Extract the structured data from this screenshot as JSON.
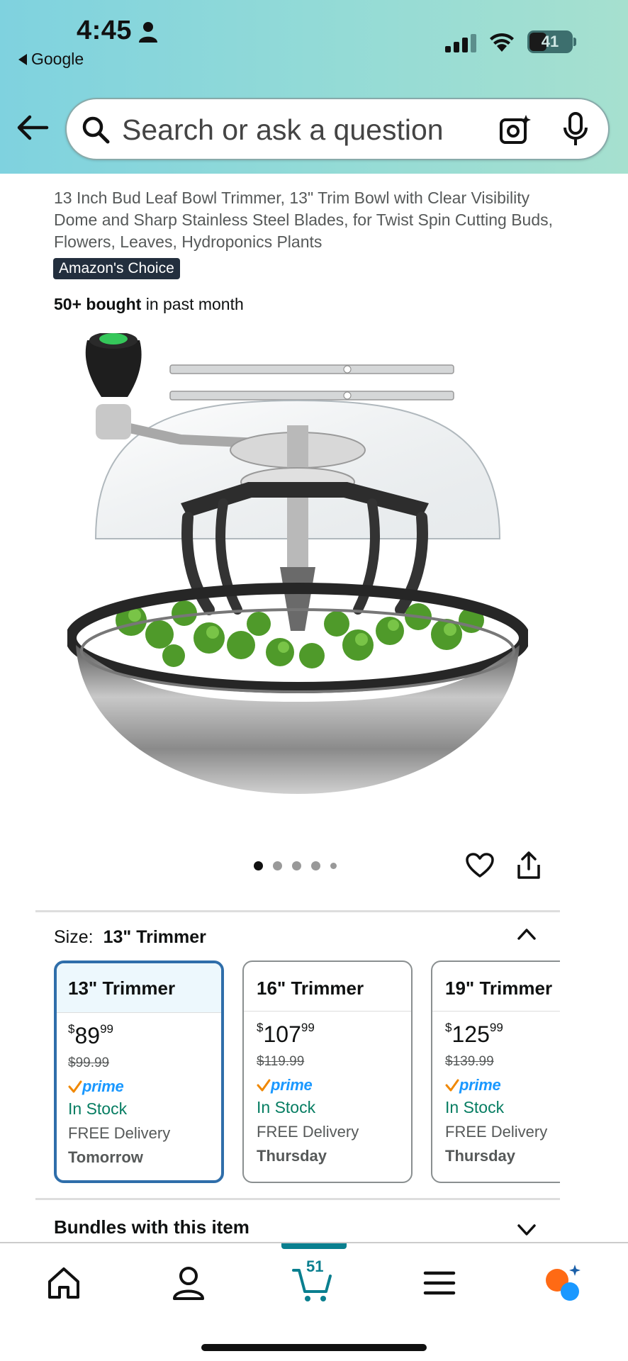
{
  "status_bar": {
    "time": "4:45",
    "back_app": "Google",
    "battery": "41"
  },
  "search": {
    "placeholder": "Search or ask a question"
  },
  "product": {
    "title": "13 Inch Bud Leaf Bowl Trimmer, 13\" Trim Bowl with Clear Visibility Dome and Sharp Stainless Steel Blades, for Twist Spin Cutting Buds, Flowers, Leaves, Hydroponics Plants",
    "badge": "Amazon's Choice",
    "bought_bold": "50+ bought",
    "bought_rest": " in past month",
    "image_count": 5,
    "image_index": 1
  },
  "size_selector": {
    "label": "Size:",
    "selected": "13\" Trimmer",
    "options": [
      {
        "name": "13\" Trimmer",
        "currency": "$",
        "whole": "89",
        "cents": "99",
        "was": "$99.99",
        "prime": "prime",
        "stock": "In Stock",
        "delivery": "FREE Delivery",
        "day": "Tomorrow"
      },
      {
        "name": "16\" Trimmer",
        "currency": "$",
        "whole": "107",
        "cents": "99",
        "was": "$119.99",
        "prime": "prime",
        "stock": "In Stock",
        "delivery": "FREE Delivery",
        "day": "Thursday"
      },
      {
        "name": "19\" Trimmer",
        "currency": "$",
        "whole": "125",
        "cents": "99",
        "was": "$139.99",
        "prime": "prime",
        "stock": "In Stock",
        "delivery": "FREE Delivery",
        "day": "Thursday"
      }
    ]
  },
  "bundles": {
    "label": "Bundles with this item"
  },
  "tabbar": {
    "cart_count": "51",
    "active_tab": "cart"
  },
  "colors": {
    "prime_blue": "#1a98ff",
    "in_stock_green": "#067d62",
    "selected_border": "#2f6eaa",
    "tab_accent": "#0a7f8f"
  }
}
